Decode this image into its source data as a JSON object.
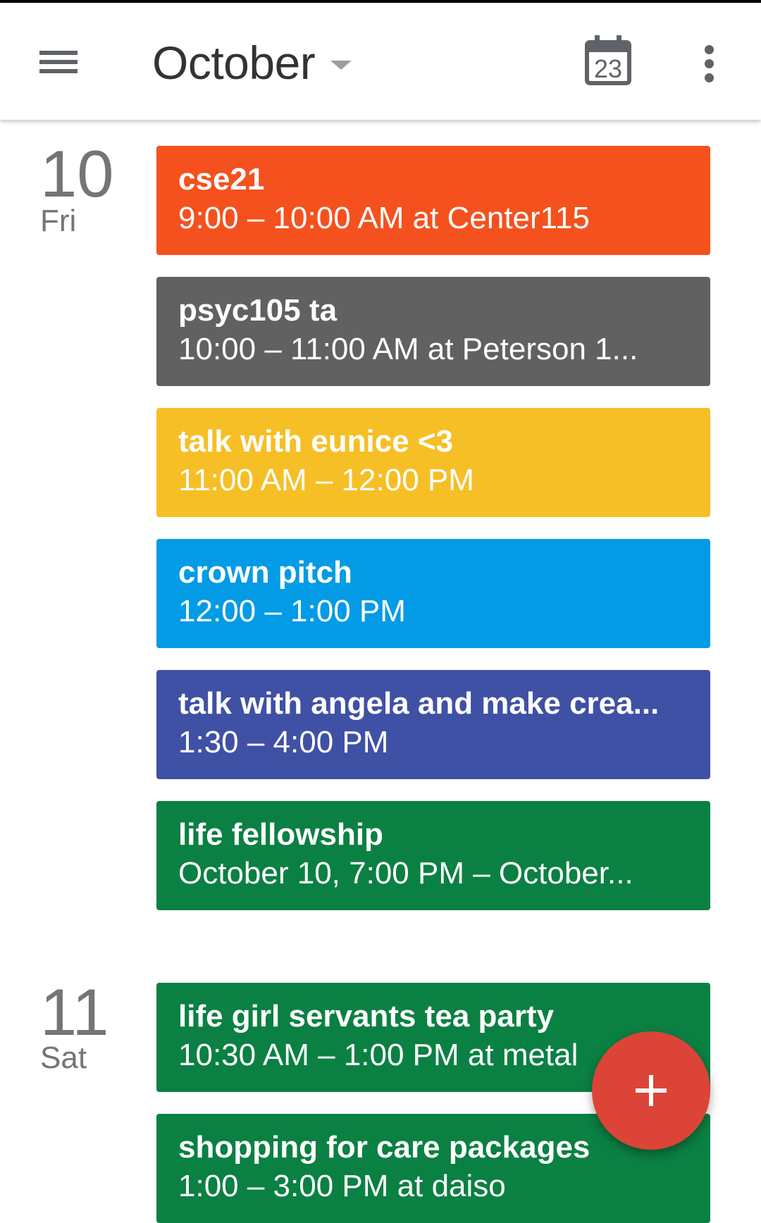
{
  "header": {
    "month": "October",
    "today_date": "23"
  },
  "days": [
    {
      "number": "10",
      "weekday": "Fri",
      "events": [
        {
          "title": "cse21",
          "detail": "9:00 – 10:00 AM at Center115",
          "color": "#f4511e"
        },
        {
          "title": "psyc105 ta",
          "detail": "10:00 – 11:00 AM at Peterson 1...",
          "color": "#616161"
        },
        {
          "title": "talk with eunice <3",
          "detail": "11:00 AM – 12:00 PM",
          "color": "#f6bf26"
        },
        {
          "title": "crown pitch",
          "detail": "12:00 – 1:00 PM",
          "color": "#039be5"
        },
        {
          "title": "talk with angela and make crea...",
          "detail": "1:30 – 4:00 PM",
          "color": "#3f51a5"
        },
        {
          "title": "life fellowship",
          "detail": "October 10, 7:00 PM – October...",
          "color": "#0b8043"
        }
      ]
    },
    {
      "number": "11",
      "weekday": "Sat",
      "events": [
        {
          "title": "life girl servants tea party",
          "detail": "10:30 AM – 1:00 PM at metal",
          "color": "#0b8043"
        },
        {
          "title": "shopping for care packages",
          "detail": "1:00 – 3:00 PM at daiso",
          "color": "#0b8043"
        }
      ]
    }
  ],
  "fab": {
    "icon": "plus-icon",
    "color": "#db4437"
  }
}
